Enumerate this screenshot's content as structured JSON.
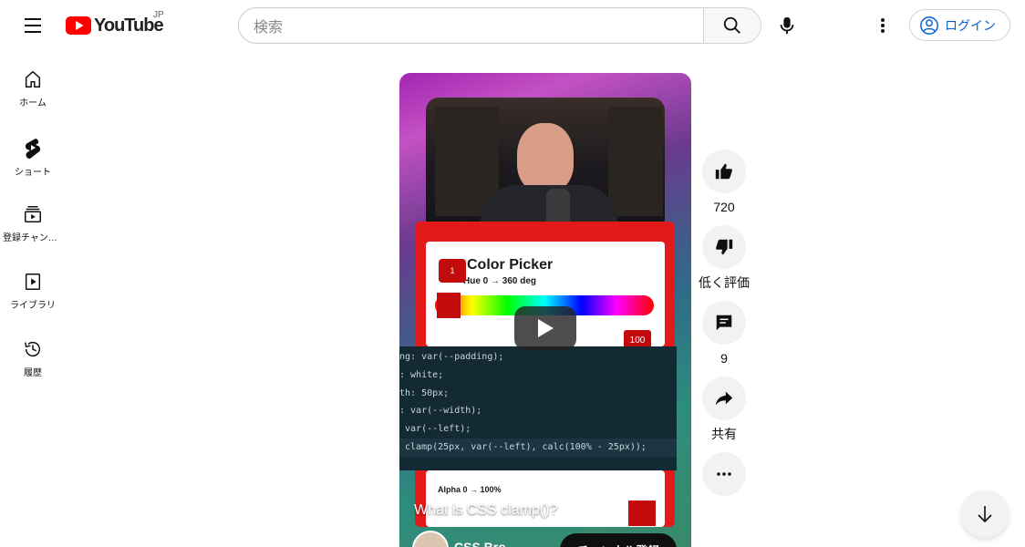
{
  "header": {
    "logo_text": "YouTube",
    "region": "JP",
    "search_placeholder": "検索",
    "login_label": "ログイン"
  },
  "sidebar": {
    "items": [
      {
        "label": "ホーム",
        "icon": "home-icon"
      },
      {
        "label": "ショート",
        "icon": "shorts-icon"
      },
      {
        "label": "登録チャンネル",
        "icon": "subscriptions-icon"
      },
      {
        "label": "ライブラリ",
        "icon": "library-icon"
      },
      {
        "label": "履歴",
        "icon": "history-icon"
      }
    ]
  },
  "short": {
    "title": "What is CSS clamp()?",
    "channel": "CSS Bro...",
    "subscribe_label": "チャンネル登録",
    "video": {
      "picker_title": "Color Picker",
      "hue_label": "Hue 0 → 360 deg",
      "tooltip_value": "1",
      "badge_value": "100",
      "alpha_label": "Alpha 0 → 100%",
      "code_lines": [
        "ng: var(--padding);",
        ": white;",
        "th: 50px;",
        ": var(--width);",
        " var(--left);",
        " clamp(25px, var(--left), calc(100% - 25px));"
      ]
    }
  },
  "actions": {
    "like_count": "720",
    "dislike_label": "低く評価",
    "comments_count": "9",
    "share_label": "共有"
  },
  "colors": {
    "brand_red": "#ff0000",
    "link_blue": "#065fd4"
  }
}
